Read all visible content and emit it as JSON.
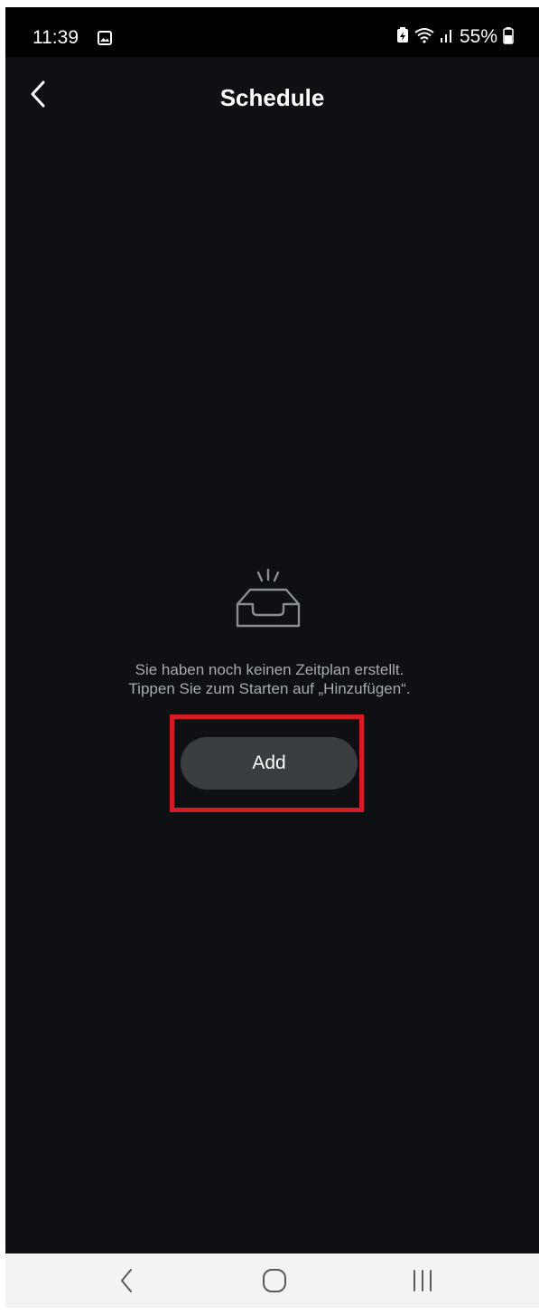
{
  "status_bar": {
    "time": "11:39",
    "battery_percent": "55%",
    "icons": [
      "gallery-icon",
      "battery-saver-icon",
      "wifi-icon",
      "signal-icon",
      "battery-icon"
    ]
  },
  "header": {
    "title": "Schedule",
    "back_icon": "chevron-left-icon"
  },
  "empty_state": {
    "icon": "empty-inbox-icon",
    "line1": "Sie haben noch keinen Zeitplan erstellt.",
    "line2": "Tippen Sie zum Starten auf „Hinzufügen“."
  },
  "actions": {
    "add_label": "Add",
    "highlight_color": "#d51b25"
  },
  "nav_bar": {
    "items": [
      "back-icon",
      "home-icon",
      "recents-icon"
    ]
  },
  "colors": {
    "background": "#0e1013",
    "button": "#393c40",
    "text_secondary": "#a7abb1"
  }
}
